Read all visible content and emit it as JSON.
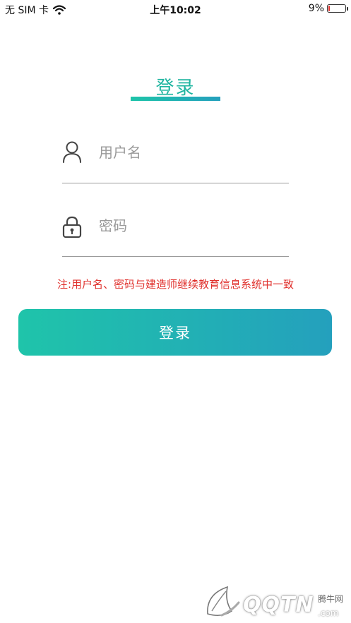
{
  "status_bar": {
    "carrier": "无 SIM 卡",
    "time": "上午10:02",
    "battery_text": "9%",
    "battery_level_percent": 9,
    "icons": {
      "wifi": "wifi-icon",
      "battery": "battery-icon"
    }
  },
  "login": {
    "title": "登录",
    "username": {
      "placeholder": "用户名",
      "value": "",
      "icon": "user-icon"
    },
    "password": {
      "placeholder": "密码",
      "value": "",
      "icon": "lock-icon"
    },
    "notice": "注:用户名、密码与建造师继续教育信息系统中一致",
    "button_label": "登录"
  },
  "watermark": {
    "brand": "QQTN",
    "suffix": ".com",
    "cn_name": "腾牛网"
  },
  "colors": {
    "accent_start": "#1ec4a9",
    "accent_end": "#25a0bd",
    "notice": "#e0302c",
    "placeholder": "#9a9a9a"
  }
}
